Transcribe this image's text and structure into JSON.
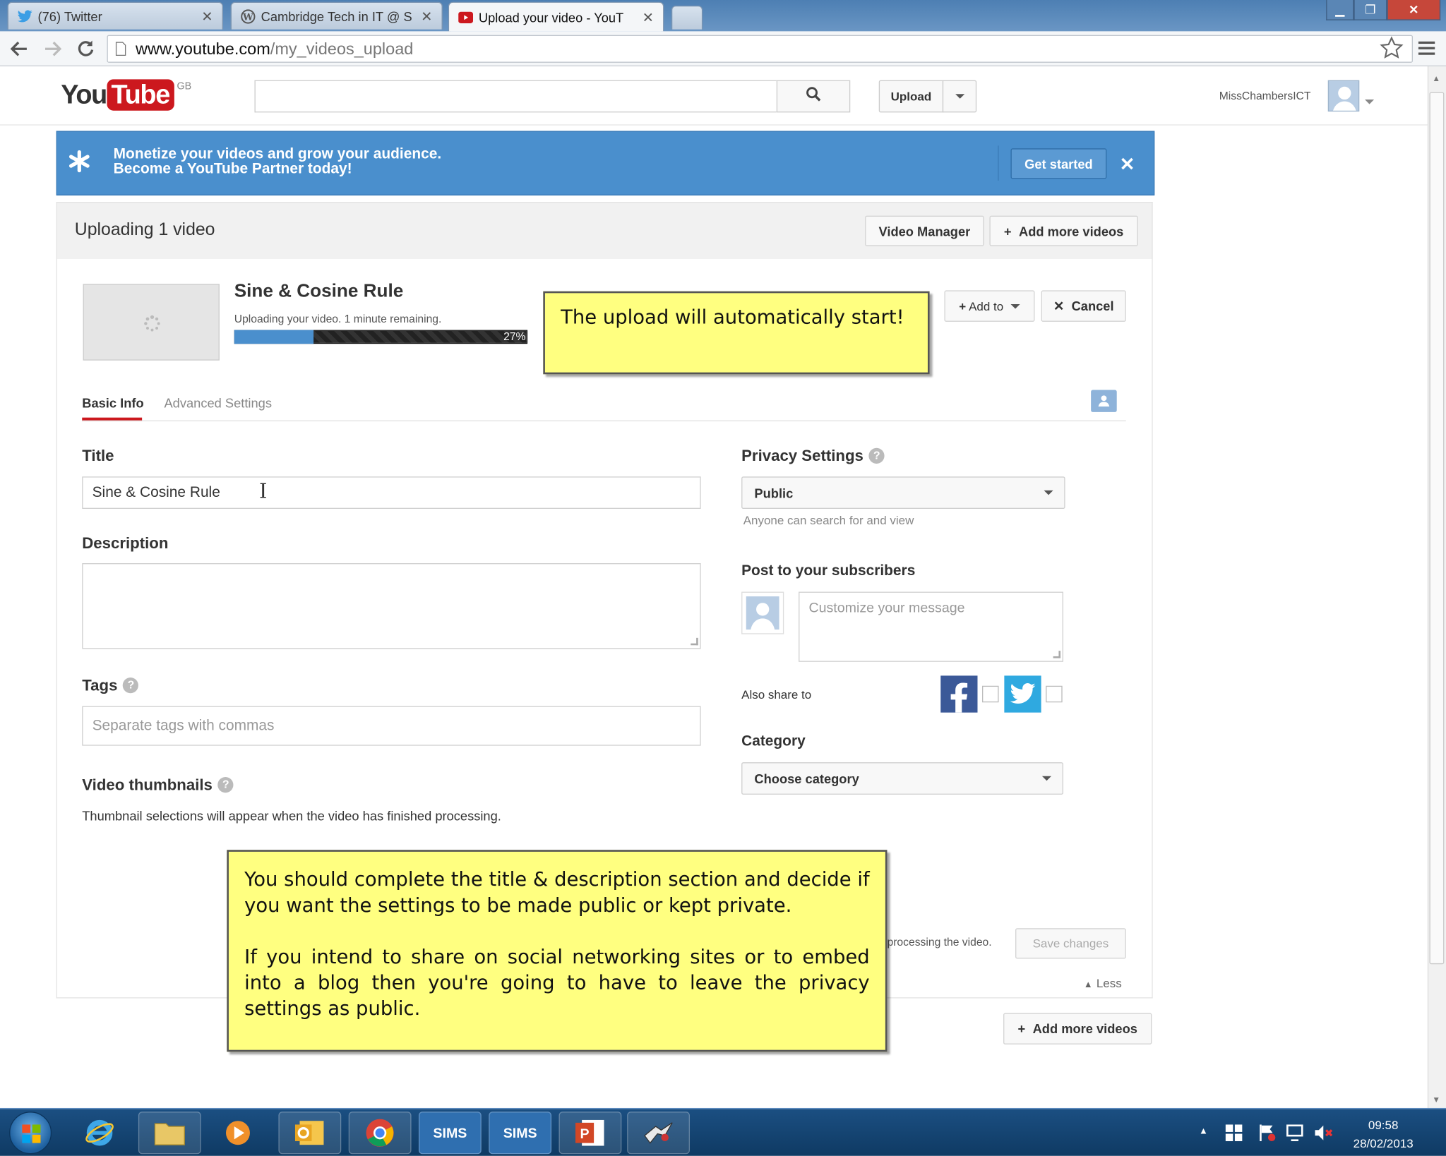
{
  "browser": {
    "tabs": [
      {
        "label": "(76) Twitter",
        "icon": "twitter-icon"
      },
      {
        "label": "Cambridge Tech in IT @ S",
        "icon": "wordpress-icon"
      },
      {
        "label": "Upload your video - YouT",
        "icon": "youtube-icon",
        "active": true
      }
    ],
    "url_host": "www.youtube.com",
    "url_path": "/my_videos_upload"
  },
  "header": {
    "logo_you": "You",
    "logo_tube": "Tube",
    "logo_region": "GB",
    "search_placeholder": "",
    "upload_label": "Upload",
    "username": "MissChambersICT"
  },
  "banner": {
    "line1": "Monetize your videos and grow your audience.",
    "line2": "Become a YouTube Partner today!",
    "cta": "Get started",
    "close": "✕"
  },
  "upload": {
    "heading": "Uploading 1 video",
    "video_manager": "Video Manager",
    "add_more": "Add more videos",
    "video_title": "Sine & Cosine Rule",
    "status": "Uploading your video. 1 minute remaining.",
    "progress_percent": 27,
    "progress_label": "27%",
    "add_to": "Add to",
    "cancel": "Cancel"
  },
  "tabs": {
    "basic": "Basic Info",
    "advanced": "Advanced Settings"
  },
  "form": {
    "title_label": "Title",
    "title_value": "Sine & Cosine Rule",
    "description_label": "Description",
    "description_value": "",
    "tags_label": "Tags",
    "tags_placeholder": "Separate tags with commas",
    "thumbs_label": "Video thumbnails",
    "thumbs_note": "Thumbnail selections will appear when the video has finished processing.",
    "privacy_label": "Privacy Settings",
    "privacy_value": "Public",
    "privacy_hint": "Anyone can search for and view",
    "subscribers_label": "Post to your subscribers",
    "message_placeholder": "Customize your message",
    "also_share": "Also share to",
    "category_label": "Category",
    "category_value": "Choose category",
    "processing_fragment": "processing the video.",
    "save_changes": "Save changes",
    "less": "Less"
  },
  "notes": {
    "top": "The upload will automatically start!",
    "bottom_p1": "You should complete the title & description section and decide if you want the settings to be made public or kept private.",
    "bottom_p2": "If you intend to share on social networking sites or to embed into a blog then you're going to have to leave the privacy settings as public."
  },
  "taskbar": {
    "sims1": "SIMS",
    "sims2": "SIMS",
    "time": "09:58",
    "date": "28/02/2013"
  },
  "colors": {
    "brand_red": "#cc181e",
    "banner_blue": "#4a8fcd",
    "note_yellow": "#ffff80"
  }
}
